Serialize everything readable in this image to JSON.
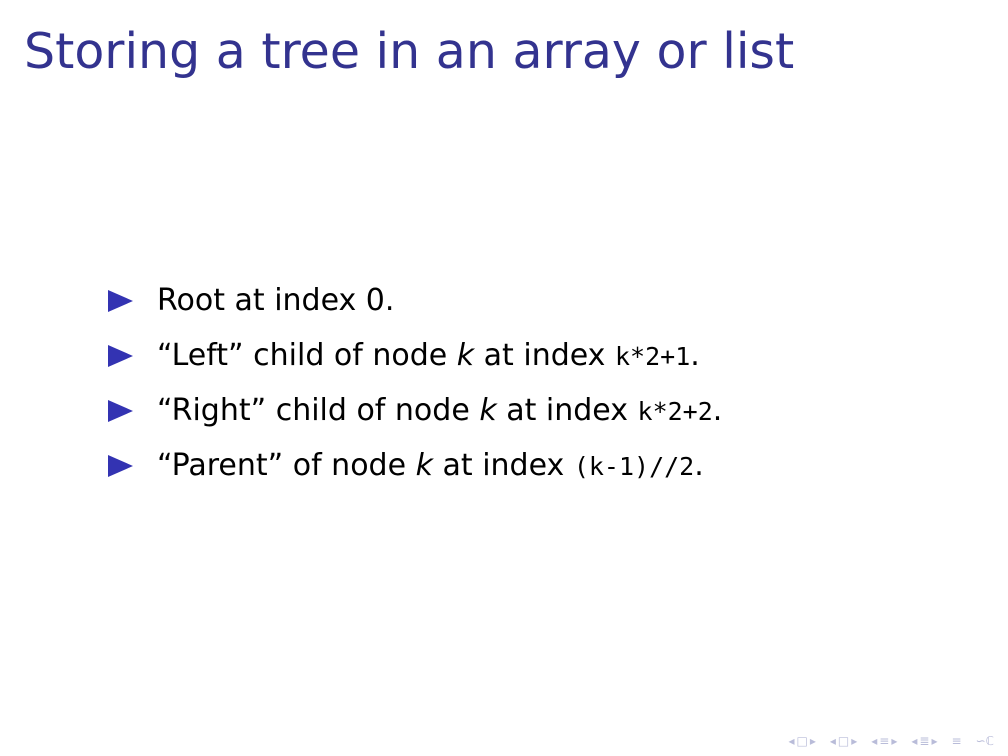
{
  "slide": {
    "title": "Storing a tree in an array or list",
    "bullets": [
      {
        "before": "Root at index 0.",
        "var": "",
        "middle": "",
        "code": "",
        "after": ""
      },
      {
        "before": "“Left” child of node ",
        "var": "k",
        "middle": " at index ",
        "code": "k*2+1",
        "after": "."
      },
      {
        "before": "“Right” child of node ",
        "var": "k",
        "middle": " at index ",
        "code": "k*2+2",
        "after": "."
      },
      {
        "before": "“Parent” of node ",
        "var": "k",
        "middle": " at index ",
        "code": "(k-1)//2",
        "after": "."
      }
    ]
  },
  "navigation": {
    "icons": [
      "arrow-left-icon",
      "frame-icon",
      "arrow-right-icon",
      "arrow-left-icon",
      "subsection-icon",
      "arrow-right-icon",
      "arrow-left-icon",
      "section-icon",
      "arrow-right-icon",
      "arrow-left-icon",
      "document-icon",
      "arrow-right-icon",
      "align-icon",
      "search-icon"
    ],
    "glyphs": {
      "left": "◂",
      "right": "▸",
      "frame": "□",
      "subsection": "≡",
      "section": "≣",
      "document": "☰",
      "align": "≡",
      "search": "∽ℂ"
    }
  },
  "colors": {
    "title": "#33338f",
    "bullet": "#3333b2",
    "nav": "#b9bcd9"
  }
}
